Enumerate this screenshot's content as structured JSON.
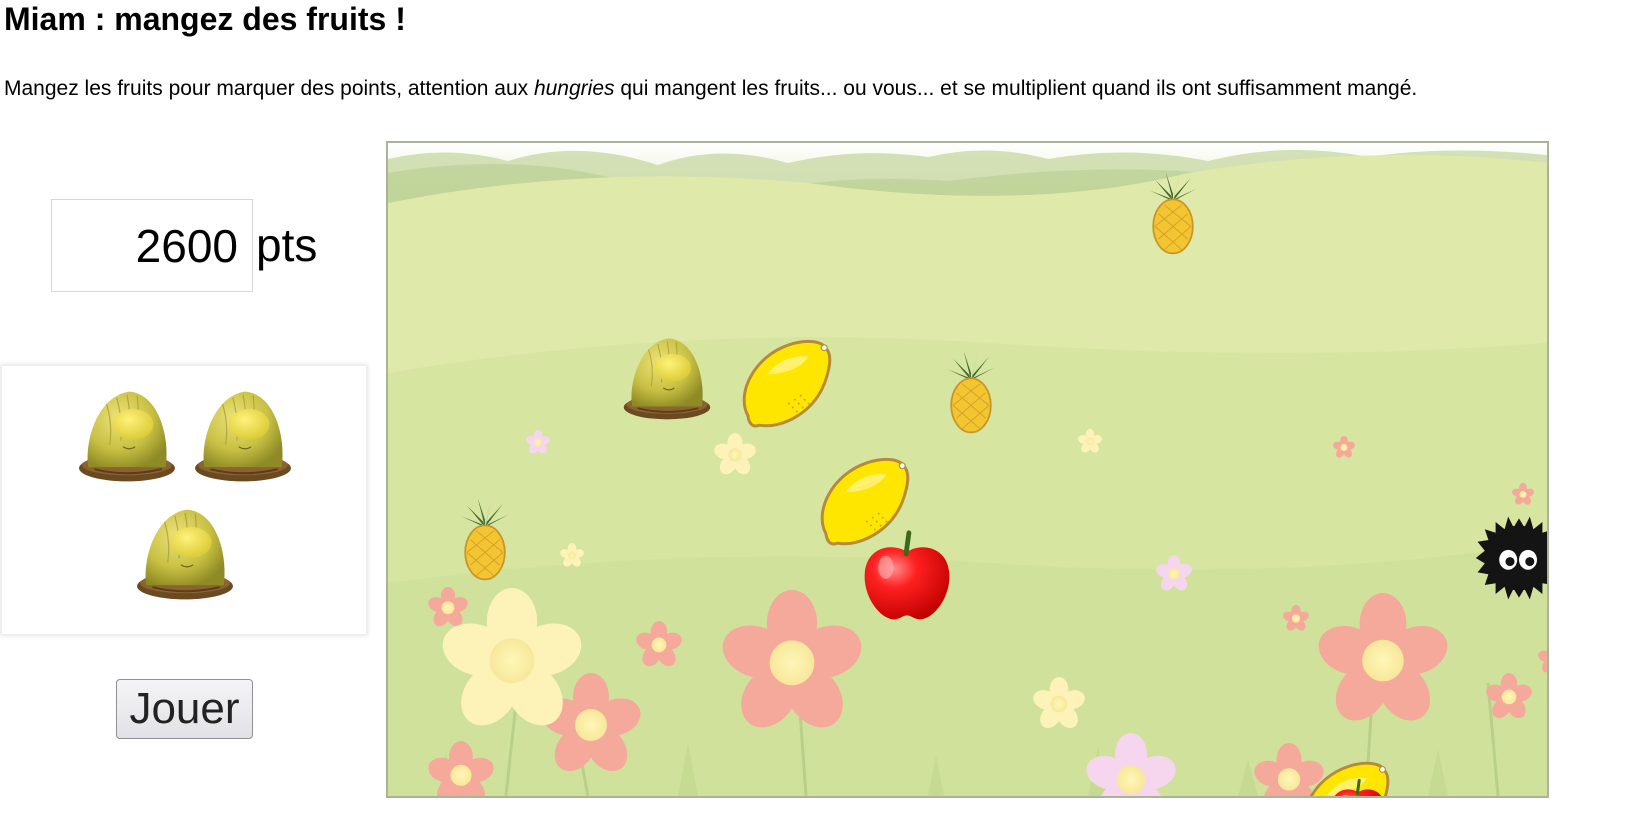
{
  "page": {
    "title": "Miam : mangez des fruits !",
    "intro_before": "Mangez les fruits pour marquer des points, attention aux ",
    "intro_em": "hungries",
    "intro_after": " qui mangent les fruits... ou vous... et se multiplient quand ils ont suffisamment mangé."
  },
  "score": {
    "value": "2600",
    "unit": "pts"
  },
  "lives": {
    "remaining": 3,
    "icon": "player-creature-icon"
  },
  "controls": {
    "play_label": "Jouer"
  },
  "board": {
    "sprites": [
      "hungry-creature-icon",
      "lemon-icon",
      "lemon-icon",
      "lemon-icon",
      "pineapple-icon",
      "pineapple-icon",
      "pineapple-icon",
      "apple-icon",
      "apple-icon",
      "soot-sprite-icon"
    ],
    "colors": {
      "sky": "#f3f7e4",
      "hills": "#b9cd8f",
      "meadow": "#dbe7a2",
      "lemon": "#ffe600",
      "apple": "#e8151e",
      "pineapple": "#f2c531",
      "creature": "#c9c34a",
      "soot": "#141414",
      "flower": "#f4a99a"
    }
  }
}
